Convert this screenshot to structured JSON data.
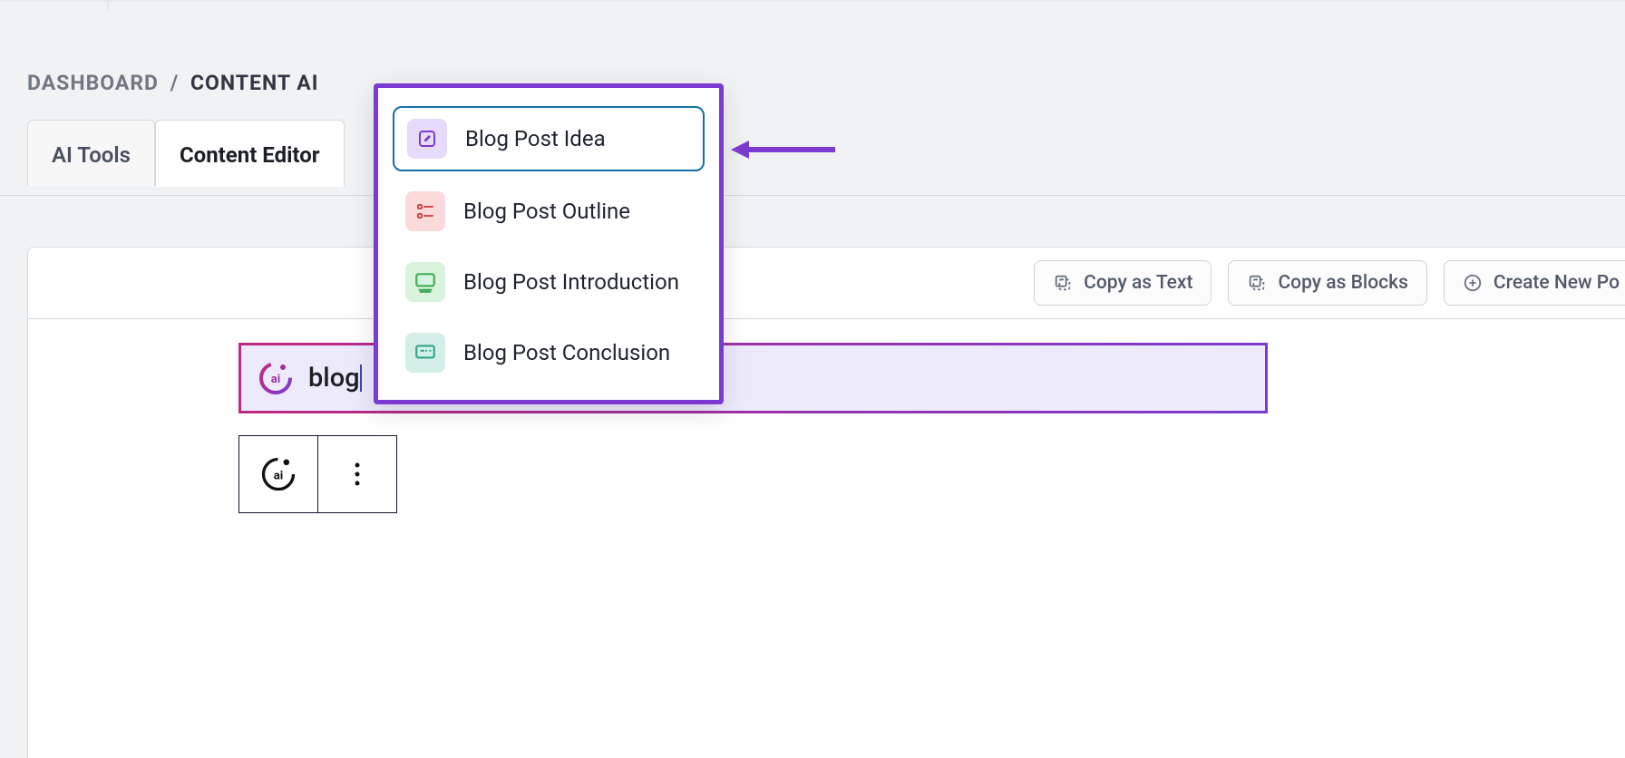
{
  "breadcrumb": {
    "root": "DASHBOARD",
    "separator": "/",
    "current": "CONTENT AI"
  },
  "tabs": {
    "items": [
      {
        "label": "AI Tools"
      },
      {
        "label": "Content Editor"
      }
    ],
    "active_index": 1
  },
  "toolbar": {
    "copy_text": "Copy as Text",
    "copy_blocks": "Copy as Blocks",
    "create_post": "Create New Po"
  },
  "prompt": {
    "value": "blog"
  },
  "dropdown": {
    "items": [
      {
        "label": "Blog Post Idea"
      },
      {
        "label": "Blog Post Outline"
      },
      {
        "label": "Blog Post Introduction"
      },
      {
        "label": "Blog Post Conclusion"
      }
    ],
    "selected_index": 0
  }
}
